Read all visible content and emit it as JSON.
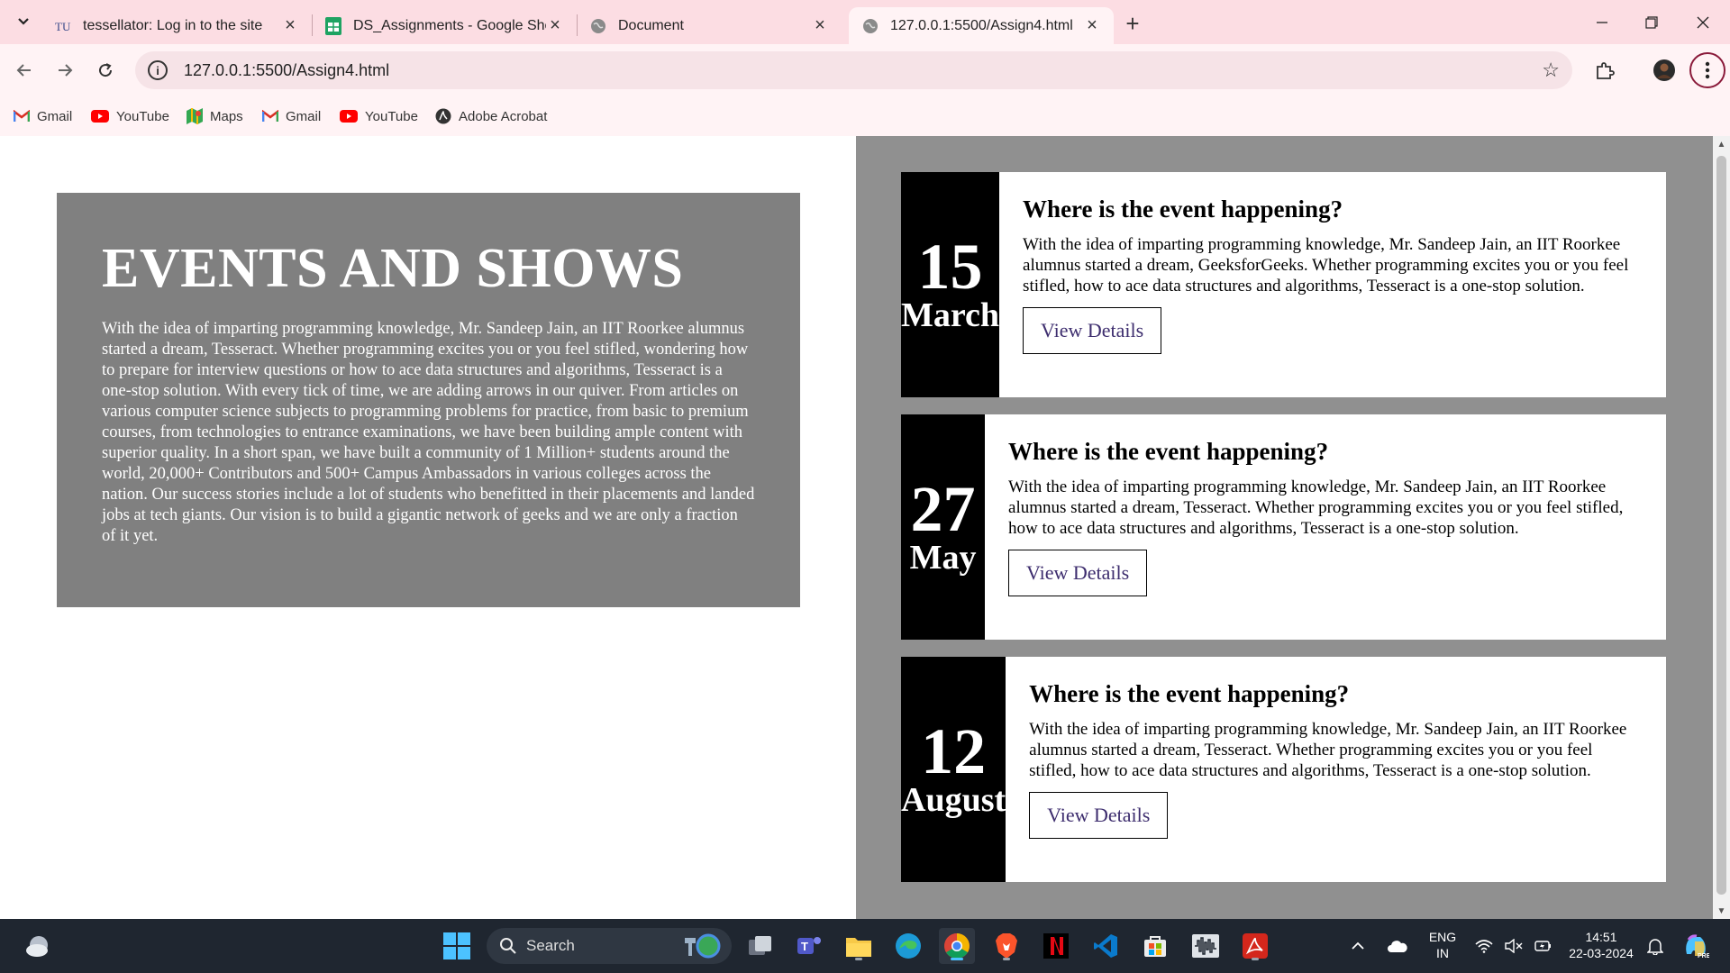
{
  "browser": {
    "tabs": [
      {
        "title": "tessellator: Log in to the site",
        "icon": "tessellator-icon",
        "active": false
      },
      {
        "title": "DS_Assignments - Google Shee",
        "icon": "google-sheets-icon",
        "active": false
      },
      {
        "title": "Document",
        "icon": "globe-icon",
        "active": false
      },
      {
        "title": "127.0.0.1:5500/Assign4.html",
        "icon": "globe-icon",
        "active": true
      }
    ],
    "url": "127.0.0.1:5500/Assign4.html",
    "bookmarks": [
      {
        "label": "Gmail",
        "icon": "gmail-icon"
      },
      {
        "label": "YouTube",
        "icon": "youtube-icon"
      },
      {
        "label": "Maps",
        "icon": "maps-icon"
      },
      {
        "label": "Gmail",
        "icon": "gmail-icon"
      },
      {
        "label": "YouTube",
        "icon": "youtube-icon"
      },
      {
        "label": "Adobe Acrobat",
        "icon": "acrobat-icon"
      }
    ]
  },
  "page": {
    "heading": "EVENTS AND SHOWS",
    "intro": "With the idea of imparting programming knowledge, Mr. Sandeep Jain, an IIT Roorkee alumnus started a dream, Tesseract. Whether programming excites you or you feel stifled, wondering how to prepare for interview questions or how to ace data structures and algorithms, Tesseract is a one-stop solution. With every tick of time, we are adding arrows in our quiver. From articles on various computer science subjects to programming problems for practice, from basic to premium courses, from technologies to entrance examinations, we have been building ample content with superior quality. In a short span, we have built a community of 1 Million+ students around the world, 20,000+ Contributors and 500+ Campus Ambassadors in various colleges across the nation. Our success stories include a lot of students who benefitted in their placements and landed jobs at tech giants. Our vision is to build a gigantic network of geeks and we are only a fraction of it yet.",
    "events": [
      {
        "day": "15",
        "month": "March",
        "title": "Where is the event happening?",
        "description": "With the idea of imparting programming knowledge, Mr. Sandeep Jain, an IIT Roorkee alumnus started a dream, GeeksforGeeks. Whether programming excites you or you feel stifled, how to ace data structures and algorithms, Tesseract is a one-stop solution.",
        "button": "View Details"
      },
      {
        "day": "27",
        "month": "May",
        "title": "Where is the event happening?",
        "description": "With the idea of imparting programming knowledge, Mr. Sandeep Jain, an IIT Roorkee alumnus started a dream, Tesseract. Whether programming excites you or you feel stifled, how to ace data structures and algorithms, Tesseract is a one-stop solution.",
        "button": "View Details"
      },
      {
        "day": "12",
        "month": "August",
        "title": "Where is the event happening?",
        "description": "With the idea of imparting programming knowledge, Mr. Sandeep Jain, an IIT Roorkee alumnus started a dream, Tesseract. Whether programming excites you or you feel stifled, how to ace data structures and algorithms, Tesseract is a one-stop solution.",
        "button": "View Details"
      }
    ]
  },
  "taskbar": {
    "search_placeholder": "Search",
    "language": "ENG",
    "region": "IN",
    "time": "14:51",
    "date": "22-03-2024",
    "apps": [
      "task-view-icon",
      "teams-icon",
      "file-explorer-icon",
      "edge-icon",
      "chrome-icon",
      "brave-icon",
      "netflix-icon",
      "vscode-icon",
      "store-icon",
      "audio-app-icon",
      "acrobat-icon"
    ]
  },
  "colors": {
    "tabstrip": "#fcdde3",
    "left_panel": "#808080",
    "right_panel": "#909090",
    "date_block": "#000000",
    "button_text": "#3d2d6e",
    "taskbar": "#1f2630"
  }
}
